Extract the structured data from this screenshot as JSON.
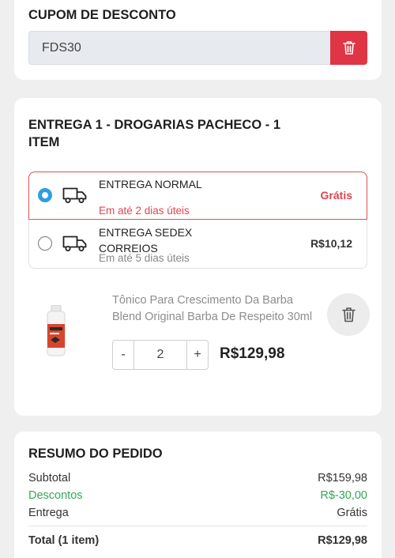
{
  "coupon": {
    "title": "CUPOM DE DESCONTO",
    "code": "FDS30"
  },
  "delivery": {
    "title": "ENTREGA 1 - DROGARIAS PACHECO - 1 ITEM",
    "options": [
      {
        "name": "ENTREGA NORMAL",
        "eta": "Em até 2 dias úteis",
        "price": "Grátis",
        "selected": true
      },
      {
        "name": "ENTREGA SEDEX CORREIOS",
        "eta": "Em até 5 dias úteis",
        "price": "R$10,12",
        "selected": false
      }
    ]
  },
  "product": {
    "name": "Tônico Para Crescimento Da Barba Blend Original Barba De Respeito 30ml",
    "minus_label": "-",
    "quantity": "2",
    "plus_label": "+",
    "price": "R$129,98"
  },
  "summary": {
    "title": "RESUMO DO PEDIDO",
    "subtotal_label": "Subtotal",
    "subtotal_value": "R$159,98",
    "discount_label": "Descontos",
    "discount_value": "R$-30,00",
    "shipping_label": "Entrega",
    "shipping_value": "Grátis",
    "total_label": "Total (1 item)",
    "total_value": "R$129,98"
  },
  "colors": {
    "accent_red": "#e03545",
    "radio_blue": "#2e9ee0",
    "discount_green": "#33a852"
  },
  "icons": [
    "trash-icon",
    "truck-icon"
  ]
}
